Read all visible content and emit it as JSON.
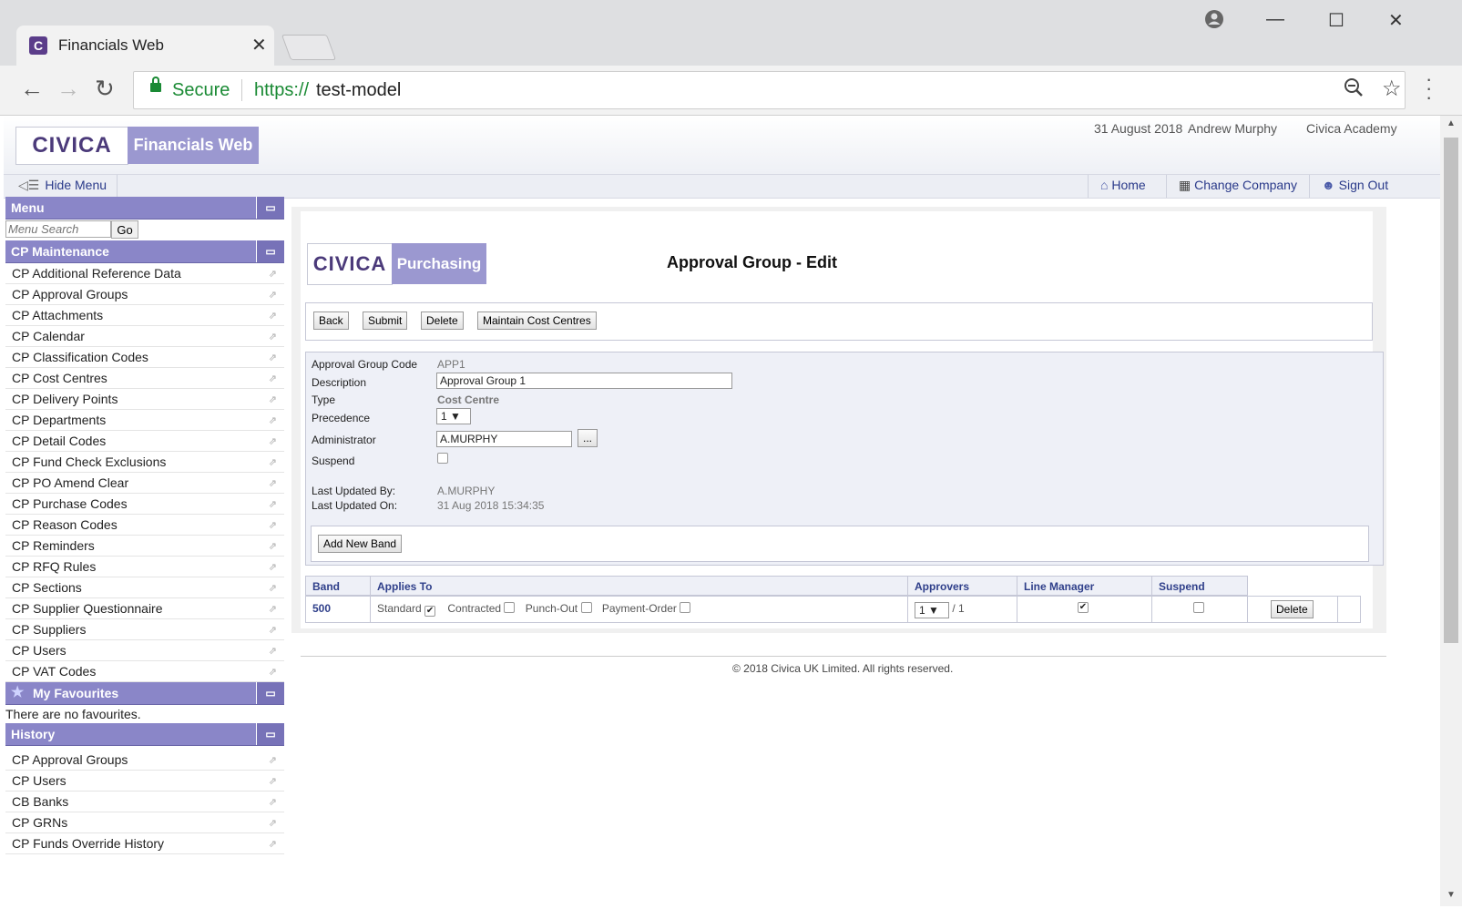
{
  "browser": {
    "tab_title": "Financials Web",
    "tab_favicon": "C",
    "secure_label": "Secure",
    "url_scheme": "https://",
    "url_host": "test-model"
  },
  "header": {
    "logo": "CIVICA",
    "product": "Financials Web",
    "date": "31 August 2018",
    "user": "Andrew Murphy",
    "company": "Civica Academy"
  },
  "subbar": {
    "hide_menu": "Hide Menu",
    "home": "Home",
    "change_company": "Change Company",
    "sign_out": "Sign Out"
  },
  "sidebar": {
    "menu_title": "Menu",
    "search_placeholder": "Menu Search",
    "go": "Go",
    "section_title": "CP Maintenance",
    "items": [
      "CP Additional Reference Data",
      "CP Approval Groups",
      "CP Attachments",
      "CP Calendar",
      "CP Classification Codes",
      "CP Cost Centres",
      "CP Delivery Points",
      "CP Departments",
      "CP Detail Codes",
      "CP Fund Check Exclusions",
      "CP PO Amend Clear",
      "CP Purchase Codes",
      "CP Reason Codes",
      "CP Reminders",
      "CP RFQ Rules",
      "CP Sections",
      "CP Supplier Questionnaire",
      "CP Suppliers",
      "CP Users",
      "CP VAT Codes"
    ],
    "favourites_title": "My Favourites",
    "favourites_empty": "There are no favourites.",
    "history_title": "History",
    "history": [
      "CP Approval Groups",
      "CP Users",
      "CB Banks",
      "CP GRNs",
      "CP Funds Override History"
    ]
  },
  "main": {
    "logo": "CIVICA",
    "product": "Purchasing",
    "title": "Approval Group - Edit",
    "buttons": {
      "back": "Back",
      "submit": "Submit",
      "delete": "Delete",
      "maintain": "Maintain Cost Centres"
    },
    "form": {
      "code_label": "Approval Group Code",
      "code": "APP1",
      "desc_label": "Description",
      "desc": "Approval Group 1",
      "type_label": "Type",
      "type": "Cost Centre",
      "prec_label": "Precedence",
      "prec": "1",
      "admin_label": "Administrator",
      "admin": "A.MURPHY",
      "lookup": "...",
      "suspend_label": "Suspend",
      "suspend": false,
      "upd_by_label": "Last Updated By:",
      "upd_by": "A.MURPHY",
      "upd_on_label": "Last Updated On:",
      "upd_on": "31 Aug 2018 15:34:35",
      "add_band": "Add New Band"
    },
    "grid": {
      "headers": {
        "band": "Band",
        "applies": "Applies To",
        "approvers": "Approvers",
        "line_manager": "Line Manager",
        "suspend": "Suspend"
      },
      "row": {
        "band": "500",
        "standard": "Standard",
        "standard_checked": true,
        "contracted": "Contracted",
        "contracted_checked": false,
        "punch_out": "Punch-Out",
        "punch_out_checked": false,
        "payment_order": "Payment-Order",
        "payment_order_checked": false,
        "approvers": "1",
        "approvers_total": "/ 1",
        "line_manager_checked": true,
        "suspend_checked": false,
        "delete": "Delete"
      }
    }
  },
  "footer": "© 2018 Civica UK Limited. All rights reserved."
}
